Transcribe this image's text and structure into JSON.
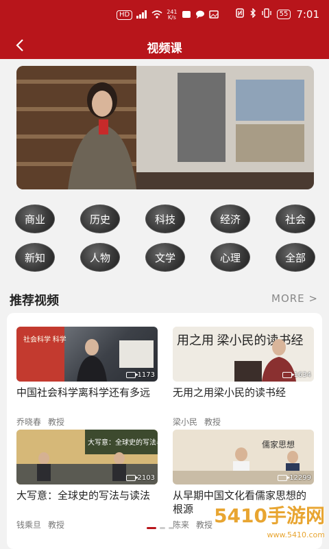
{
  "status": {
    "network_badge": "HD",
    "speed_value": "241",
    "speed_unit": "K/s",
    "battery": "55",
    "time": "7:01"
  },
  "nav": {
    "title": "视频课",
    "back_icon": "chevron-left-icon"
  },
  "categories": [
    "商业",
    "历史",
    "科技",
    "经济",
    "社会",
    "新知",
    "人物",
    "文学",
    "心理",
    "全部"
  ],
  "section": {
    "title": "推荐视频",
    "more_label": "MORE >"
  },
  "videos": [
    {
      "title": "中国社会科学离科学还有多远",
      "speaker": "乔晓春",
      "role": "教授",
      "views": "1173",
      "thumb_text": "社会科学 科学"
    },
    {
      "title": "无用之用梁小民的读书经",
      "speaker": "梁小民",
      "role": "教授",
      "views": "1634",
      "thumb_text": "用之用 梁小民的读书经"
    },
    {
      "title": "大写意：全球史的写法与读法",
      "speaker": "钱乘旦",
      "role": "教授",
      "views": "2103",
      "thumb_text": "大写意：全球史的写法与读法"
    },
    {
      "title": "从早期中国文化看儒家思想的根源",
      "speaker": "陈来",
      "role": "教授",
      "views": "12299",
      "thumb_text": "儒家思想"
    }
  ],
  "watermark": {
    "text": "5410手游网",
    "sub": "www.5410.com"
  }
}
